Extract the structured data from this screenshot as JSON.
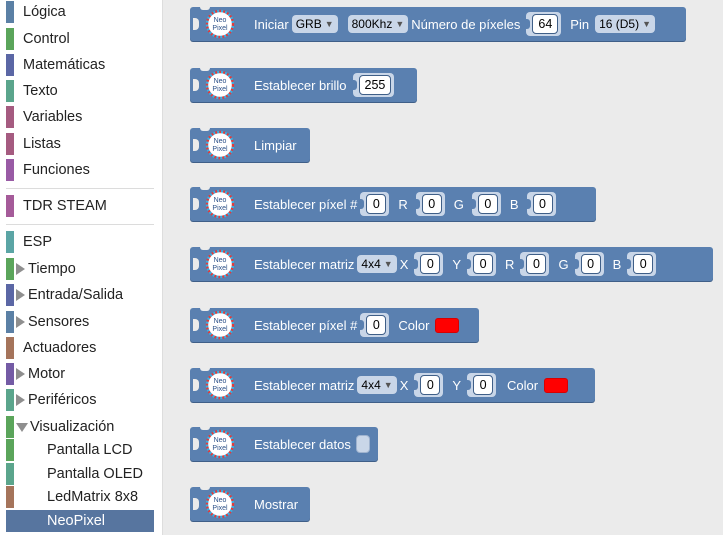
{
  "toolbox": {
    "categories": [
      {
        "label": "Lógica",
        "color": "#5b80a5"
      },
      {
        "label": "Control",
        "color": "#5ba55b"
      },
      {
        "label": "Matemáticas",
        "color": "#5b67a5"
      },
      {
        "label": "Texto",
        "color": "#5ba58c"
      },
      {
        "label": "Variables",
        "color": "#a55b80"
      },
      {
        "label": "Listas",
        "color": "#745ba5"
      },
      {
        "label": "Funciones",
        "color": "#995ba5"
      },
      {
        "label": "TDR STEAM",
        "color": "#a55b99"
      },
      {
        "label": "ESP",
        "color": "#5ba5a5"
      },
      {
        "label": "Tiempo",
        "color": "#5ba55b"
      },
      {
        "label": "Entrada/Salida",
        "color": "#5b67a5"
      },
      {
        "label": "Sensores",
        "color": "#5b80a5"
      },
      {
        "label": "Actuadores",
        "color": "#a5745b"
      },
      {
        "label": "Motor",
        "color": "#745ba5"
      },
      {
        "label": "Periféricos",
        "color": "#5ba58c"
      },
      {
        "label": "Visualización",
        "color": "#5ba55b"
      },
      {
        "label": "Pantalla LCD",
        "color": "#5ba55b"
      },
      {
        "label": "Pantalla OLED",
        "color": "#5ba58c"
      },
      {
        "label": "LedMatrix 8x8",
        "color": "#a5745b"
      },
      {
        "label": "NeoPixel",
        "color": "#5b80a5"
      }
    ]
  },
  "blocks": {
    "icon_label": "Neo Pixel",
    "init": {
      "label": "Iniciar",
      "order": "GRB",
      "freq": "800Khz",
      "num_label": "Número de píxeles",
      "num": "64",
      "pin_label": "Pin",
      "pin": "16 (D5)"
    },
    "brightness": {
      "label": "Establecer brillo",
      "value": "255"
    },
    "clear": {
      "label": "Limpiar"
    },
    "set_pixel": {
      "label": "Establecer píxel #",
      "index": "0",
      "r_label": "R",
      "r": "0",
      "g_label": "G",
      "g": "0",
      "b_label": "B",
      "b": "0"
    },
    "set_matrix": {
      "label": "Establecer matriz",
      "size": "4x4",
      "x_label": "X",
      "x": "0",
      "y_label": "Y",
      "y": "0",
      "r_label": "R",
      "r": "0",
      "g_label": "G",
      "g": "0",
      "b_label": "B",
      "b": "0"
    },
    "set_pixel_color": {
      "label": "Establecer píxel #",
      "index": "0",
      "color_label": "Color",
      "color": "#ff0000"
    },
    "set_matrix_color": {
      "label": "Establecer matriz",
      "size": "4x4",
      "x_label": "X",
      "x": "0",
      "y_label": "Y",
      "y": "0",
      "color_label": "Color",
      "color": "#ff0000"
    },
    "set_data": {
      "label": "Establecer datos"
    },
    "show": {
      "label": "Mostrar"
    }
  },
  "colors": {
    "block": "#5a80b0",
    "selected": "#57759f"
  }
}
